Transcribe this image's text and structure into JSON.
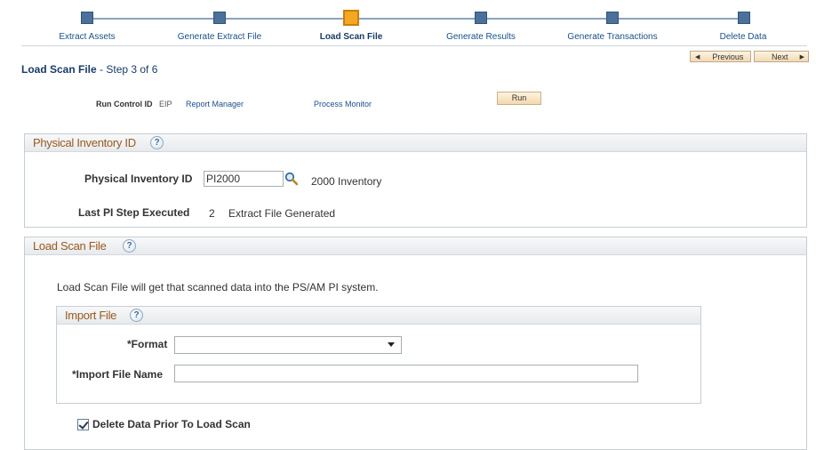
{
  "train": {
    "steps": [
      {
        "label": "Extract Assets",
        "active": false
      },
      {
        "label": "Generate Extract File",
        "active": false
      },
      {
        "label": "Load Scan File",
        "active": true
      },
      {
        "label": "Generate Results",
        "active": false
      },
      {
        "label": "Generate Transactions",
        "active": false
      },
      {
        "label": "Delete Data",
        "active": false
      }
    ]
  },
  "nav": {
    "previous_label": "Previous",
    "next_label": "Next"
  },
  "page": {
    "title": "Load Scan File",
    "step_text": " - Step 3 of 6"
  },
  "run_control": {
    "label": "Run Control ID",
    "value": "EIP",
    "report_manager": "Report Manager",
    "process_monitor": "Process Monitor",
    "run_label": "Run"
  },
  "physical_inventory": {
    "section_title": "Physical Inventory ID",
    "id_label": "Physical Inventory ID",
    "id_value": "PI2000",
    "id_description": "2000 Inventory",
    "last_step_label": "Last PI Step Executed",
    "last_step_number": "2",
    "last_step_text": "Extract File Generated"
  },
  "load_scan": {
    "section_title": "Load Scan File",
    "description": "Load Scan File will get that scanned data into the PS/AM PI system.",
    "import_file": {
      "section_title": "Import File",
      "format_label": "*Format",
      "format_value": "",
      "file_name_label": "*Import File Name",
      "file_name_value": ""
    },
    "delete_prior": {
      "label": "Delete Data Prior To Load Scan",
      "checked": true
    }
  },
  "colors": {
    "active_stop": "#f5a623",
    "stop": "#4b7099",
    "group_title": "#9a5a1e",
    "link": "#1a4f8a"
  }
}
